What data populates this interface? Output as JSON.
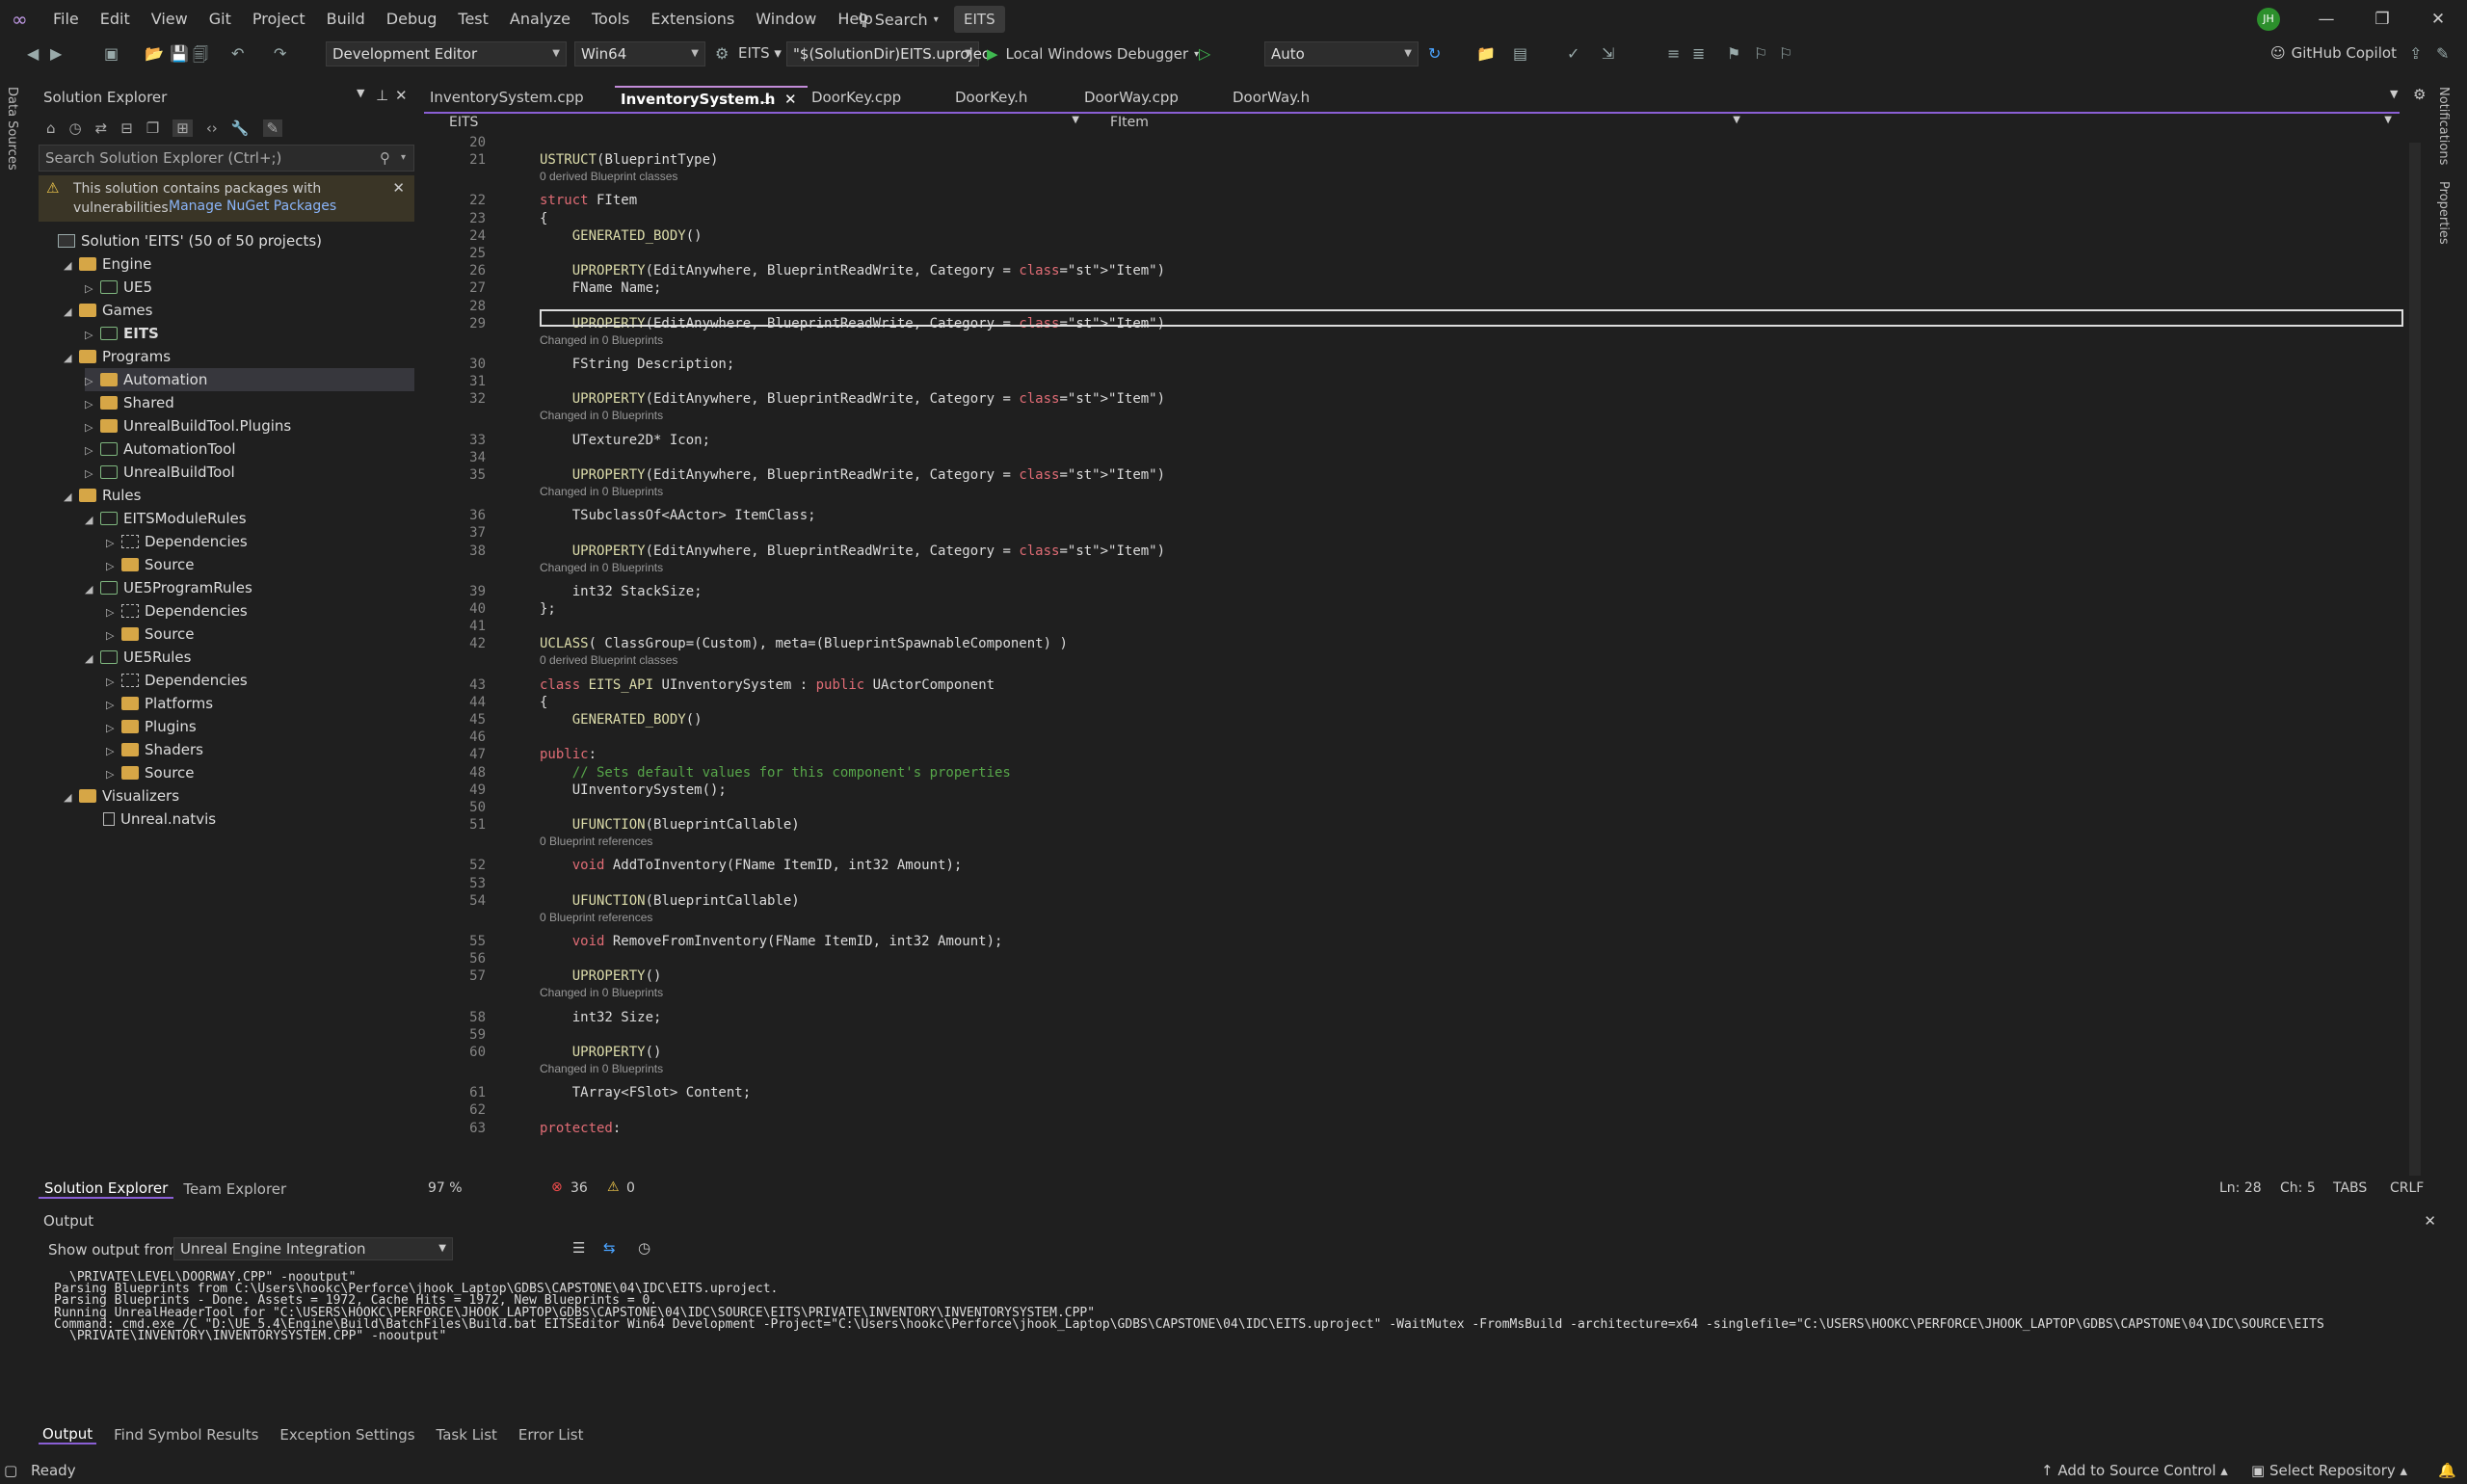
{
  "menu": [
    "File",
    "Edit",
    "View",
    "Git",
    "Project",
    "Build",
    "Debug",
    "Test",
    "Analyze",
    "Tools",
    "Extensions",
    "Window",
    "Help"
  ],
  "search_label": "Search",
  "solution_badge": "EITS",
  "avatar_initials": "JH",
  "toolbar": {
    "config": "Development Editor",
    "platform": "Win64",
    "startup": "EITS",
    "args": "\"$(SolutionDir)EITS.uprojec",
    "debugger": "Local Windows Debugger",
    "auto": "Auto",
    "copilot": "GitHub Copilot"
  },
  "side_labels": {
    "data_sources": "Data Sources",
    "notifications": "Notifications",
    "properties": "Properties"
  },
  "solution_explorer": {
    "title": "Solution Explorer",
    "search_placeholder": "Search Solution Explorer (Ctrl+;)",
    "warning_text": "This solution contains packages with vulnerabilities.",
    "warning_link": "Manage NuGet Packages",
    "tree": [
      {
        "label": "Solution 'EITS' (50 of 50 projects)",
        "indent": 0,
        "tw": "",
        "icon": "sol"
      },
      {
        "label": "Engine",
        "indent": 1,
        "tw": "◢",
        "icon": "folder"
      },
      {
        "label": "UE5",
        "indent": 2,
        "tw": "▷",
        "icon": "proj"
      },
      {
        "label": "Games",
        "indent": 1,
        "tw": "◢",
        "icon": "folder"
      },
      {
        "label": "EITS",
        "indent": 2,
        "tw": "▷",
        "icon": "proj",
        "bold": true
      },
      {
        "label": "Programs",
        "indent": 1,
        "tw": "◢",
        "icon": "folder"
      },
      {
        "label": "Automation",
        "indent": 2,
        "tw": "▷",
        "icon": "folder",
        "selected": true
      },
      {
        "label": "Shared",
        "indent": 2,
        "tw": "▷",
        "icon": "folder"
      },
      {
        "label": "UnrealBuildTool.Plugins",
        "indent": 2,
        "tw": "▷",
        "icon": "folder"
      },
      {
        "label": "AutomationTool",
        "indent": 2,
        "tw": "▷",
        "icon": "proj"
      },
      {
        "label": "UnrealBuildTool",
        "indent": 2,
        "tw": "▷",
        "icon": "proj"
      },
      {
        "label": "Rules",
        "indent": 1,
        "tw": "◢",
        "icon": "folder"
      },
      {
        "label": "EITSModuleRules",
        "indent": 2,
        "tw": "◢",
        "icon": "proj"
      },
      {
        "label": "Dependencies",
        "indent": 3,
        "tw": "▷",
        "icon": "dep"
      },
      {
        "label": "Source",
        "indent": 3,
        "tw": "▷",
        "icon": "folder"
      },
      {
        "label": "UE5ProgramRules",
        "indent": 2,
        "tw": "◢",
        "icon": "proj"
      },
      {
        "label": "Dependencies",
        "indent": 3,
        "tw": "▷",
        "icon": "dep"
      },
      {
        "label": "Source",
        "indent": 3,
        "tw": "▷",
        "icon": "folder"
      },
      {
        "label": "UE5Rules",
        "indent": 2,
        "tw": "◢",
        "icon": "proj"
      },
      {
        "label": "Dependencies",
        "indent": 3,
        "tw": "▷",
        "icon": "dep"
      },
      {
        "label": "Platforms",
        "indent": 3,
        "tw": "▷",
        "icon": "folder"
      },
      {
        "label": "Plugins",
        "indent": 3,
        "tw": "▷",
        "icon": "folder"
      },
      {
        "label": "Shaders",
        "indent": 3,
        "tw": "▷",
        "icon": "folder"
      },
      {
        "label": "Source",
        "indent": 3,
        "tw": "▷",
        "icon": "folder"
      },
      {
        "label": "Visualizers",
        "indent": 1,
        "tw": "◢",
        "icon": "folder"
      },
      {
        "label": "Unreal.natvis",
        "indent": 2,
        "tw": "",
        "icon": "file"
      }
    ],
    "bottom_tabs": [
      "Solution Explorer",
      "Team Explorer"
    ]
  },
  "editor_tabs": [
    "InventorySystem.cpp",
    "InventorySystem.h",
    "DoorKey.cpp",
    "DoorKey.h",
    "DoorWay.cpp",
    "DoorWay.h"
  ],
  "active_tab": "InventorySystem.h",
  "nav": {
    "project": "EITS",
    "scope": "FItem"
  },
  "code_lines": [
    {
      "n": "20",
      "t": ""
    },
    {
      "n": "21",
      "t": "USTRUCT(BlueprintType)",
      "lens": "0 derived Blueprint classes"
    },
    {
      "n": "22",
      "t": "struct FItem"
    },
    {
      "n": "23",
      "t": "{"
    },
    {
      "n": "24",
      "t": "    GENERATED_BODY()"
    },
    {
      "n": "25",
      "t": ""
    },
    {
      "n": "26",
      "t": "    UPROPERTY(EditAnywhere, BlueprintReadWrite, Category = \"Item\")"
    },
    {
      "n": "27",
      "t": "    FName Name;"
    },
    {
      "n": "28",
      "t": ""
    },
    {
      "n": "29",
      "t": "    UPROPERTY(EditAnywhere, BlueprintReadWrite, Category = \"Item\")",
      "lens": "Changed in 0 Blueprints"
    },
    {
      "n": "30",
      "t": "    FString Description;"
    },
    {
      "n": "31",
      "t": ""
    },
    {
      "n": "32",
      "t": "    UPROPERTY(EditAnywhere, BlueprintReadWrite, Category = \"Item\")",
      "lens": "Changed in 0 Blueprints"
    },
    {
      "n": "33",
      "t": "    UTexture2D* Icon;"
    },
    {
      "n": "34",
      "t": ""
    },
    {
      "n": "35",
      "t": "    UPROPERTY(EditAnywhere, BlueprintReadWrite, Category = \"Item\")",
      "lens": "Changed in 0 Blueprints"
    },
    {
      "n": "36",
      "t": "    TSubclassOf<AActor> ItemClass;"
    },
    {
      "n": "37",
      "t": ""
    },
    {
      "n": "38",
      "t": "    UPROPERTY(EditAnywhere, BlueprintReadWrite, Category = \"Item\")",
      "lens": "Changed in 0 Blueprints"
    },
    {
      "n": "39",
      "t": "    int32 StackSize;"
    },
    {
      "n": "40",
      "t": "};"
    },
    {
      "n": "41",
      "t": ""
    },
    {
      "n": "42",
      "t": "UCLASS( ClassGroup=(Custom), meta=(BlueprintSpawnableComponent) )",
      "lens": "0 derived Blueprint classes"
    },
    {
      "n": "43",
      "t": "class EITS_API UInventorySystem : public UActorComponent"
    },
    {
      "n": "44",
      "t": "{"
    },
    {
      "n": "45",
      "t": "    GENERATED_BODY()"
    },
    {
      "n": "46",
      "t": ""
    },
    {
      "n": "47",
      "t": "public:"
    },
    {
      "n": "48",
      "t": "    // Sets default values for this component's properties"
    },
    {
      "n": "49",
      "t": "    UInventorySystem();"
    },
    {
      "n": "50",
      "t": ""
    },
    {
      "n": "51",
      "t": "    UFUNCTION(BlueprintCallable)",
      "lens": "0 Blueprint references"
    },
    {
      "n": "52",
      "t": "    void AddToInventory(FName ItemID, int32 Amount);"
    },
    {
      "n": "53",
      "t": ""
    },
    {
      "n": "54",
      "t": "    UFUNCTION(BlueprintCallable)",
      "lens": "0 Blueprint references"
    },
    {
      "n": "55",
      "t": "    void RemoveFromInventory(FName ItemID, int32 Amount);"
    },
    {
      "n": "56",
      "t": ""
    },
    {
      "n": "57",
      "t": "    UPROPERTY()",
      "lens": "Changed in 0 Blueprints"
    },
    {
      "n": "58",
      "t": "    int32 Size;"
    },
    {
      "n": "59",
      "t": ""
    },
    {
      "n": "60",
      "t": "    UPROPERTY()",
      "lens": "Changed in 0 Blueprints"
    },
    {
      "n": "61",
      "t": "    TArray<FSlot> Content;"
    },
    {
      "n": "62",
      "t": ""
    },
    {
      "n": "63",
      "t": "protected:"
    }
  ],
  "editor_status": {
    "zoom": "97 %",
    "errors": "36",
    "warnings": "0",
    "line": "Ln: 28",
    "col": "Ch: 5",
    "tabs": "TABS",
    "eol": "CRLF"
  },
  "output": {
    "title": "Output",
    "show_from_label": "Show output from:",
    "source": "Unreal Engine Integration",
    "lines": [
      "\\PRIVATE\\LEVEL\\DOORWAY.CPP\" -nooutput\"",
      "Parsing Blueprints from C:\\Users\\hookc\\Perforce\\jhook_Laptop\\GDBS\\CAPSTONE\\04\\IDC\\EITS.uproject.",
      "Parsing Blueprints - Done. Assets = 1972, Cache Hits = 1972, New Blueprints = 0.",
      "Running UnrealHeaderTool for \"C:\\USERS\\HOOKC\\PERFORCE\\JHOOK_LAPTOP\\GDBS\\CAPSTONE\\04\\IDC\\SOURCE\\EITS\\PRIVATE\\INVENTORY\\INVENTORYSYSTEM.CPP\"",
      "Command: cmd.exe /C \"D:\\UE_5.4\\Engine\\Build\\BatchFiles\\Build.bat EITSEditor Win64 Development -Project=\"C:\\Users\\hookc\\Perforce\\jhook_Laptop\\GDBS\\CAPSTONE\\04\\IDC\\EITS.uproject\" -WaitMutex -FromMsBuild -architecture=x64 -singlefile=\"C:\\USERS\\HOOKC\\PERFORCE\\JHOOK_LAPTOP\\GDBS\\CAPSTONE\\04\\IDC\\SOURCE\\EITS",
      "\\PRIVATE\\INVENTORY\\INVENTORYSYSTEM.CPP\" -nooutput\""
    ],
    "tabs": [
      "Output",
      "Find Symbol Results",
      "Exception Settings",
      "Task List",
      "Error List"
    ]
  },
  "status": {
    "ready": "Ready",
    "add_source": "Add to Source Control",
    "select_repo": "Select Repository"
  },
  "colors": {
    "accent": "#8a5fd5",
    "keyword": "#e06c75",
    "type": "#e5c07b",
    "comment": "#57a64a"
  }
}
